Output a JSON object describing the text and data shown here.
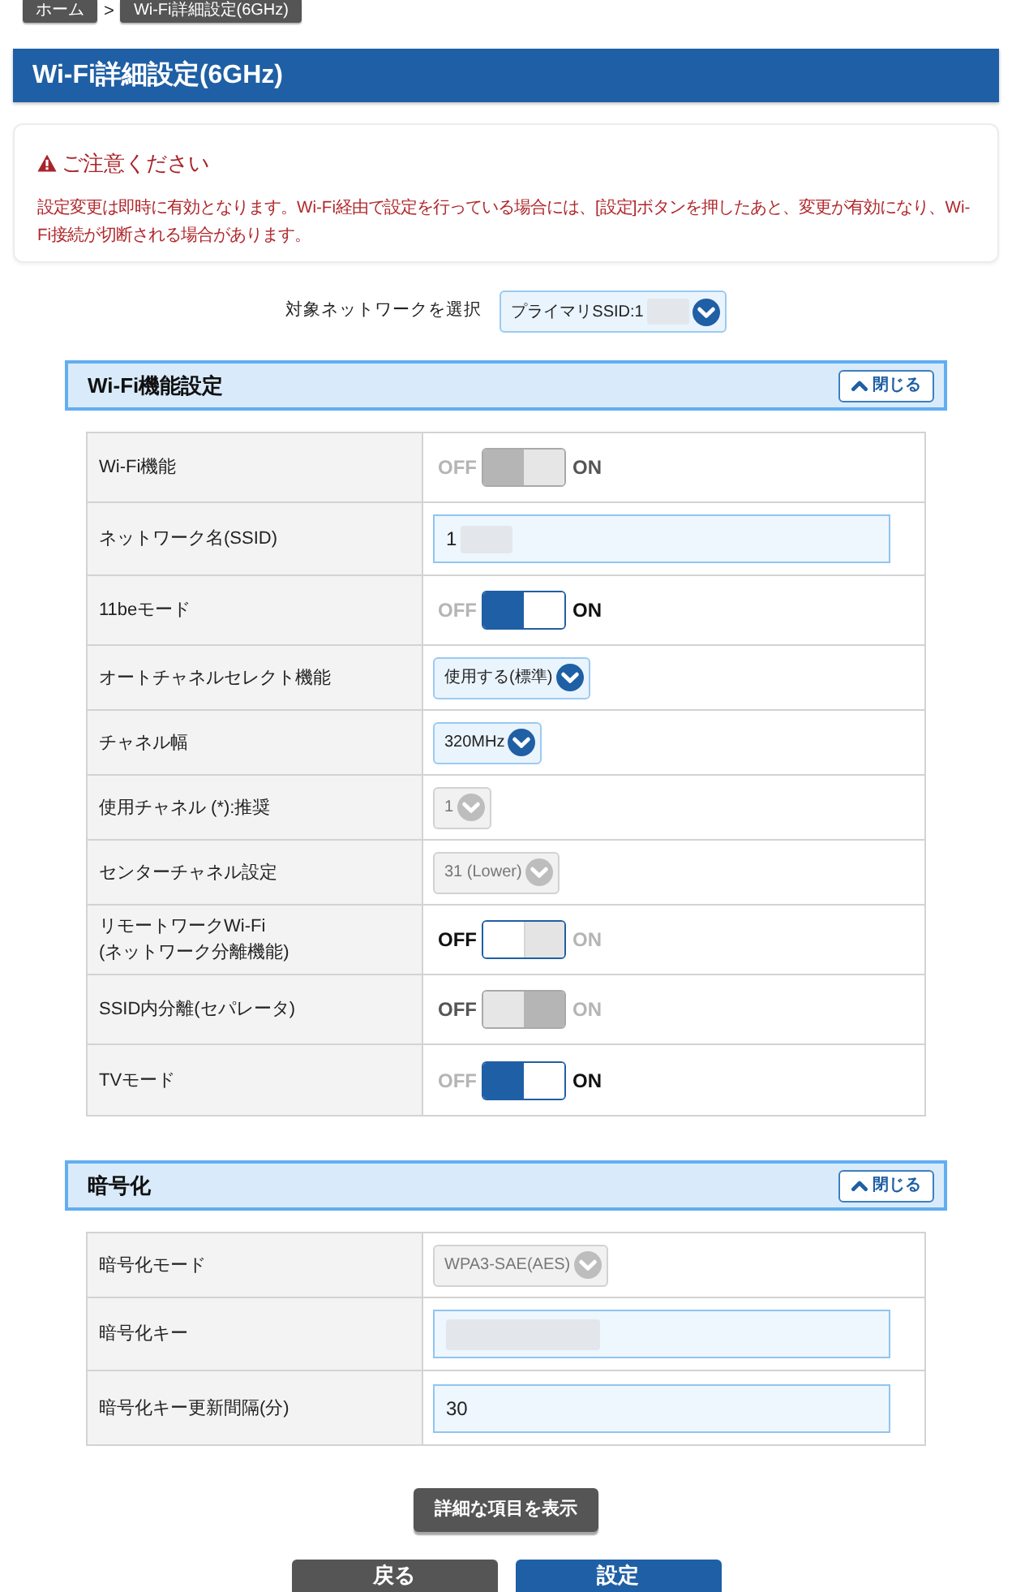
{
  "breadcrumb": {
    "items": [
      {
        "label": "ホーム"
      },
      {
        "label": "Wi-Fi詳細設定(6GHz)"
      }
    ],
    "separator": ">"
  },
  "page_title": "Wi-Fi詳細設定(6GHz)",
  "notice": {
    "title": "ご注意ください",
    "body": "設定変更は即時に有効となります。Wi-Fi経由で設定を行っている場合には、[設定]ボタンを押したあと、変更が有効になり、Wi-Fi接続が切断される場合があります。"
  },
  "network_select": {
    "label": "対象ネットワークを選択",
    "value": "プライマリSSID:1",
    "redacted": true
  },
  "sections": [
    {
      "title": "Wi-Fi機能設定",
      "close_button": "閉じる",
      "rows": [
        {
          "label": "Wi-Fi機能",
          "kind": "toggle",
          "on": true,
          "disabled": true,
          "off_label": "OFF",
          "on_label": "ON"
        },
        {
          "label": "ネットワーク名(SSID)",
          "kind": "text",
          "value": "1",
          "redacted": true
        },
        {
          "label": "11beモード",
          "kind": "toggle",
          "on": true,
          "disabled": false,
          "off_label": "OFF",
          "on_label": "ON"
        },
        {
          "label": "オートチャネルセレクト機能",
          "kind": "select",
          "value": "使用する(標準)",
          "disabled": false
        },
        {
          "label": "チャネル幅",
          "kind": "select",
          "value": "320MHz",
          "disabled": false
        },
        {
          "label": "使用チャネル (*):推奨",
          "kind": "select",
          "value": "1",
          "disabled": true
        },
        {
          "label": "センターチャネル設定",
          "kind": "select",
          "value": "31 (Lower)",
          "disabled": true
        },
        {
          "label": "リモートワークWi-Fi\n(ネットワーク分離機能)",
          "kind": "toggle",
          "on": false,
          "disabled": false,
          "off_label": "OFF",
          "on_label": "ON"
        },
        {
          "label": "SSID内分離(セパレータ)",
          "kind": "toggle",
          "on": false,
          "disabled": true,
          "off_label": "OFF",
          "on_label": "ON"
        },
        {
          "label": "TVモード",
          "kind": "toggle",
          "on": true,
          "disabled": false,
          "off_label": "OFF",
          "on_label": "ON"
        }
      ]
    },
    {
      "title": "暗号化",
      "close_button": "閉じる",
      "rows": [
        {
          "label": "暗号化モード",
          "kind": "select",
          "value": "WPA3-SAE(AES)",
          "disabled": true
        },
        {
          "label": "暗号化キー",
          "kind": "text",
          "redacted": true
        },
        {
          "label": "暗号化キー更新間隔(分)",
          "kind": "text",
          "value": "30"
        }
      ]
    }
  ],
  "details_button": "詳細な項目を表示",
  "buttons": [
    {
      "label": "戻る",
      "kind": "back"
    },
    {
      "label": "設定",
      "kind": "submit"
    }
  ]
}
